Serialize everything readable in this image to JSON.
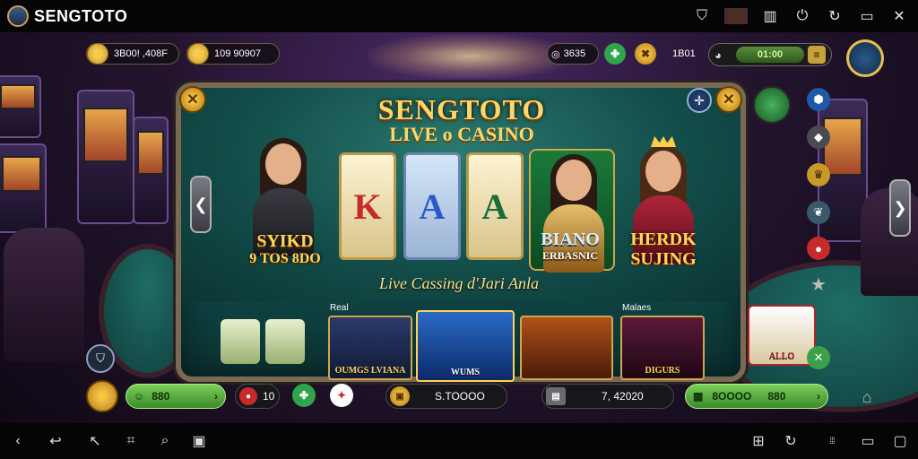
{
  "app": {
    "title": "SENGTOTO"
  },
  "header": {
    "balance_1": "3B00! ,408F",
    "balance_2": "109 90907",
    "stat_1": "3635",
    "stat_2": "1B01",
    "timer": "01:00"
  },
  "banner": {
    "logo_line1": "SENGTOTO",
    "logo_line2": "LIVE o CASINO",
    "tagline": "Live Cassing d'Jari Anla",
    "cards": [
      "K",
      "A",
      "A"
    ],
    "host_left_name": "SYIKD",
    "host_left_sub": "9 TOS 8DO",
    "host_mid_name": "BIANO",
    "host_mid_sub": "ERBASNIC",
    "host_right_name": "HERDK",
    "host_right_sub": "SUJING"
  },
  "games": {
    "section_left": "Real",
    "section_right": "Malaes",
    "tile_1": "OUMGS LVIANA",
    "tile_2": "WUMS",
    "tile_4": "DIGURS",
    "tile_5": "ALLO"
  },
  "betbar": {
    "balance": "880",
    "chips": "10",
    "amount": "S.TOOOO",
    "wager": "7, 42020",
    "win": "8OOOO",
    "win_2": "880"
  },
  "colors": {
    "felt": "#1b6b6a",
    "gold": "#ffd768",
    "accent_green": "#3a8a2a"
  }
}
